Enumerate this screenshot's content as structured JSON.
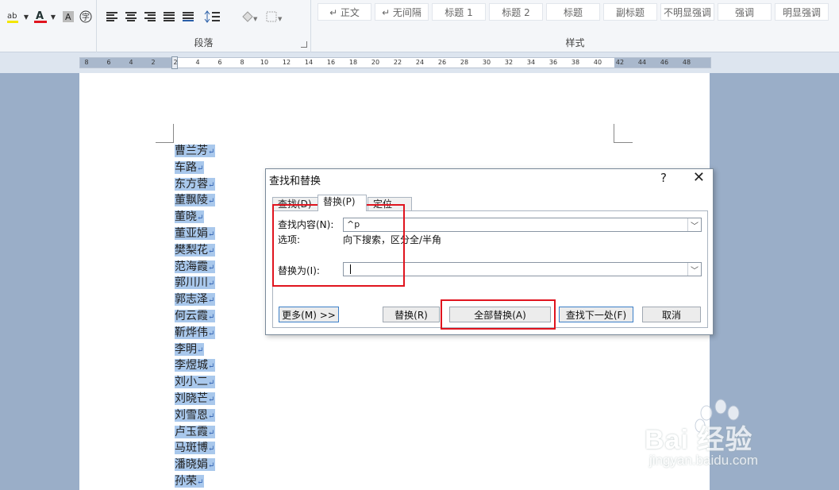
{
  "ribbon": {
    "paragraph_group_label": "段落",
    "styles_group_label": "样式",
    "style_gallery": [
      "↵ 正文",
      "↵ 无间隔",
      "标题 1",
      "标题 2",
      "标题",
      "副标题",
      "不明显强调",
      "强调",
      "明显强调"
    ],
    "icons": [
      "highlight-icon",
      "font-color-icon",
      "char-shading-icon",
      "encircle-char-icon",
      "align-left-icon",
      "align-center-icon",
      "align-right-icon",
      "justify-icon",
      "distributed-icon",
      "line-spacing-icon",
      "shading-icon",
      "borders-icon"
    ]
  },
  "ruler": {
    "ticks": [
      "8",
      "6",
      "4",
      "2",
      "2",
      "4",
      "6",
      "8",
      "10",
      "12",
      "14",
      "16",
      "18",
      "20",
      "22",
      "24",
      "26",
      "28",
      "30",
      "32",
      "34",
      "36",
      "38",
      "40",
      "42",
      "44",
      "46",
      "48"
    ]
  },
  "document": {
    "names": [
      "曹兰芳",
      "车路",
      "东方蓉",
      "董飘陵",
      "董晓",
      "董亚娟",
      "樊梨花",
      "范海霞",
      "郭川川",
      "郭志泽",
      "何云霞",
      "靳烨伟",
      "李明",
      "李煜城",
      "刘小二",
      "刘晓芒",
      "刘雪恩",
      "卢玉霞",
      "马斑博",
      "潘晓娟",
      "孙荣"
    ],
    "paragraph_mark": "↵"
  },
  "dialog": {
    "title": "查找和替换",
    "help": "?",
    "close": "✕",
    "tabs": [
      "查找(D)",
      "替换(P)",
      "定位(G)"
    ],
    "find_label": "查找内容(N):",
    "find_value": "^p",
    "options_label": "选项:",
    "options_value": "向下搜索，区分全/半角",
    "replace_label": "替换为(I):",
    "replace_value": "",
    "buttons": {
      "more": "更多(M) >>",
      "replace": "替换(R)",
      "replace_all": "全部替换(A)",
      "find_next": "查找下一处(F)",
      "cancel": "取消"
    }
  },
  "watermark": {
    "brand": "Bai 经验",
    "url": "jingyan.baidu.com"
  },
  "colors": {
    "selection": "#a9c8ec",
    "highlight_box": "#e0141e",
    "default_button_border": "#3c7fc8"
  }
}
